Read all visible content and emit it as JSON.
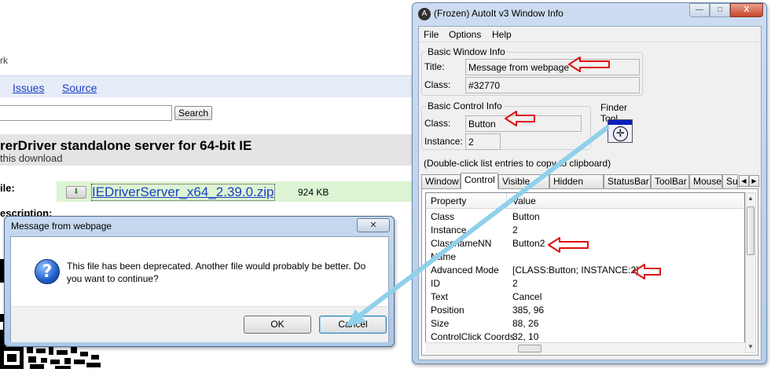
{
  "background_page": {
    "top_text": "rk",
    "nav": {
      "issues": "Issues",
      "source": "Source"
    },
    "search_button": "Search",
    "banner_title": "rerDriver standalone server for 64-bit IE",
    "banner_subtitle": "this download",
    "file_label": "ile:",
    "file_link": "IEDriverServer_x64_2.39.0.zip",
    "file_size": "924 KB",
    "description_label": "escription:"
  },
  "message_dialog": {
    "title": "Message from webpage",
    "close_glyph": "✕",
    "icon_glyph": "?",
    "text": "This file has been deprecated. Another file would probably be better. Do you want to continue?",
    "ok_label": "OK",
    "cancel_label": "Cancel"
  },
  "autoit": {
    "title": "(Frozen) AutoIt v3 Window Info",
    "controls": {
      "minimize": "—",
      "maximize": "□",
      "close": "X"
    },
    "menu": [
      "File",
      "Options",
      "Help"
    ],
    "basic_window": {
      "group_label": "Basic Window Info",
      "title_label": "Title:",
      "title_value": "Message from webpage",
      "class_label": "Class:",
      "class_value": "#32770"
    },
    "basic_control": {
      "group_label": "Basic Control Info",
      "class_label": "Class:",
      "class_value": "Button",
      "instance_label": "Instance:",
      "instance_value": "2"
    },
    "finder_label": "Finder Tool",
    "hint": "(Double-click list entries to copy to clipboard)",
    "tabs": [
      "Window",
      "Control",
      "Visible Text",
      "Hidden Text",
      "StatusBar",
      "ToolBar",
      "Mouse",
      "Su"
    ],
    "active_tab": "Control",
    "list": {
      "headers": [
        "Property",
        "Value"
      ],
      "rows": [
        [
          "Class",
          "Button"
        ],
        [
          "Instance",
          "2"
        ],
        [
          "ClassnameNN",
          "Button2"
        ],
        [
          "Name",
          ""
        ],
        [
          "Advanced Mode",
          "[CLASS:Button; INSTANCE:2]"
        ],
        [
          "ID",
          "2"
        ],
        [
          "Text",
          "Cancel"
        ],
        [
          "Position",
          "385, 96"
        ],
        [
          "Size",
          "88, 26"
        ],
        [
          "ControlClick Coords",
          "32, 10"
        ]
      ]
    }
  },
  "colors": {
    "annotation_red": "#e01010",
    "annotation_arrow": "#8fd0ea",
    "link_blue": "#1a3fc4"
  }
}
